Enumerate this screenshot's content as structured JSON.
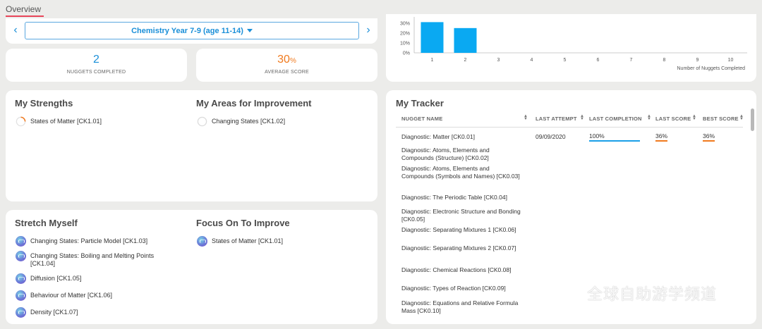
{
  "header": {
    "tab": "Overview"
  },
  "year_selector": {
    "label": "Chemistry Year 7-9 (age 11-14)"
  },
  "stats": {
    "nuggets_completed": {
      "value": "2",
      "label": "NUGGETS COMPLETED"
    },
    "average_score": {
      "value": "30",
      "unit": "%",
      "label": "AVERAGE SCORE"
    }
  },
  "chart_data": {
    "type": "bar",
    "x": [
      "1",
      "2",
      "3",
      "4",
      "5",
      "6",
      "7",
      "8",
      "9",
      "10"
    ],
    "values": [
      31,
      25,
      0,
      0,
      0,
      0,
      0,
      0,
      0,
      0
    ],
    "yticks": [
      "30%",
      "20%",
      "10%",
      "0%"
    ],
    "ylim": [
      0,
      32
    ],
    "xlabel": "Number of Nuggets Completed",
    "color": "#0aa9f2",
    "grid": false
  },
  "strengths": {
    "title": "My Strengths",
    "items": [
      {
        "label": "States of Matter [CK1.01]"
      }
    ]
  },
  "improvement": {
    "title": "My Areas for Improvement",
    "items": [
      {
        "label": "Changing States [CK1.02]"
      }
    ]
  },
  "stretch": {
    "title": "Stretch Myself",
    "items": [
      {
        "label": "Changing States: Particle Model [CK1.03]"
      },
      {
        "label": "Changing States: Boiling and Melting Points [CK1.04]"
      },
      {
        "label": "Diffusion [CK1.05]"
      },
      {
        "label": "Behaviour of Matter [CK1.06]"
      },
      {
        "label": "Density [CK1.07]"
      }
    ]
  },
  "focus": {
    "title": "Focus On To Improve",
    "items": [
      {
        "label": "States of Matter [CK1.01]"
      }
    ]
  },
  "tracker": {
    "title": "My Tracker",
    "columns": [
      "NUGGET NAME",
      "LAST ATTEMPT",
      "LAST COMPLETION",
      "LAST SCORE",
      "BEST SCORE"
    ],
    "rows": [
      {
        "name": "Diagnostic: Matter [CK0.01]",
        "last_attempt": "09/09/2020",
        "last_completion": "100%",
        "last_score": "36%",
        "best_score": "36%"
      },
      {
        "name": "Diagnostic: Atoms, Elements and Compounds (Structure) [CK0.02]"
      },
      {
        "name": "Diagnostic: Atoms, Elements and Compounds (Symbols and Names) [CK0.03]"
      },
      {
        "name": "Diagnostic: The Periodic Table [CK0.04]"
      },
      {
        "name": "Diagnostic: Electronic Structure and Bonding [CK0.05]"
      },
      {
        "name": "Diagnostic: Separating Mixtures 1 [CK0.06]"
      },
      {
        "name": "Diagnostic: Separating Mixtures 2 [CK0.07]"
      },
      {
        "name": "Diagnostic: Chemical Reactions [CK0.08]"
      },
      {
        "name": "Diagnostic: Types of Reaction [CK0.09]"
      },
      {
        "name": "Diagnostic: Equations and Relative Formula Mass [CK0.10]"
      }
    ]
  },
  "watermark": {
    "text": "全球自助游学频道"
  },
  "colors": {
    "accent": "#1a8fd8",
    "score": "#f07a1e",
    "tab_underline": "#e8455a"
  }
}
